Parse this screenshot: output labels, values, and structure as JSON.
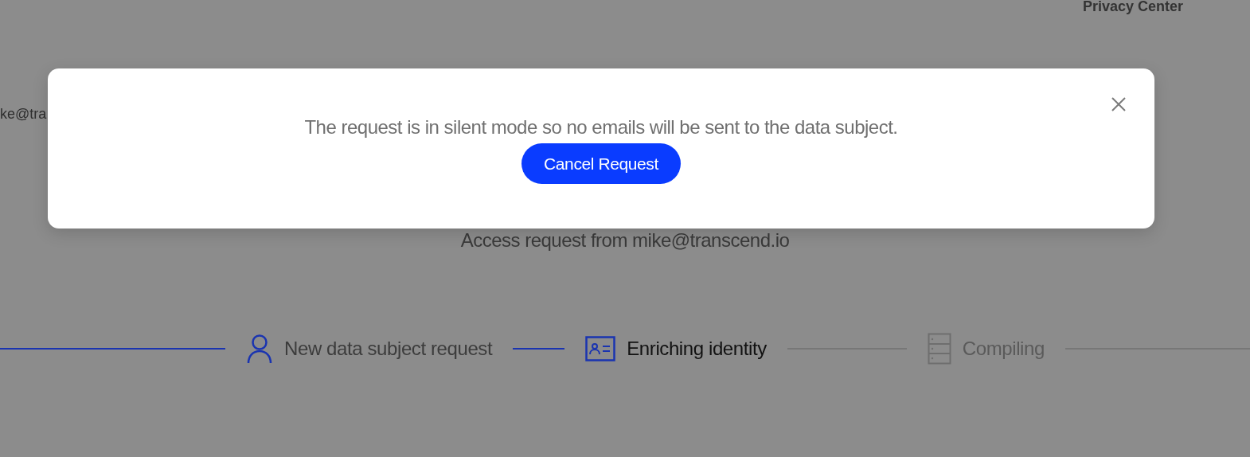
{
  "header": {
    "title": "Privacy Center"
  },
  "partial_email": "ke@tra",
  "request_summary": "Access request from mike@transcend.io",
  "steps": [
    {
      "label": "New data subject request",
      "completed": true,
      "active": false
    },
    {
      "label": "Enriching identity",
      "completed": false,
      "active": true
    },
    {
      "label": "Compiling",
      "completed": false,
      "active": false
    }
  ],
  "modal": {
    "message": "The request is in silent mode so no emails will be sent to the data subject.",
    "button": "Cancel Request"
  }
}
